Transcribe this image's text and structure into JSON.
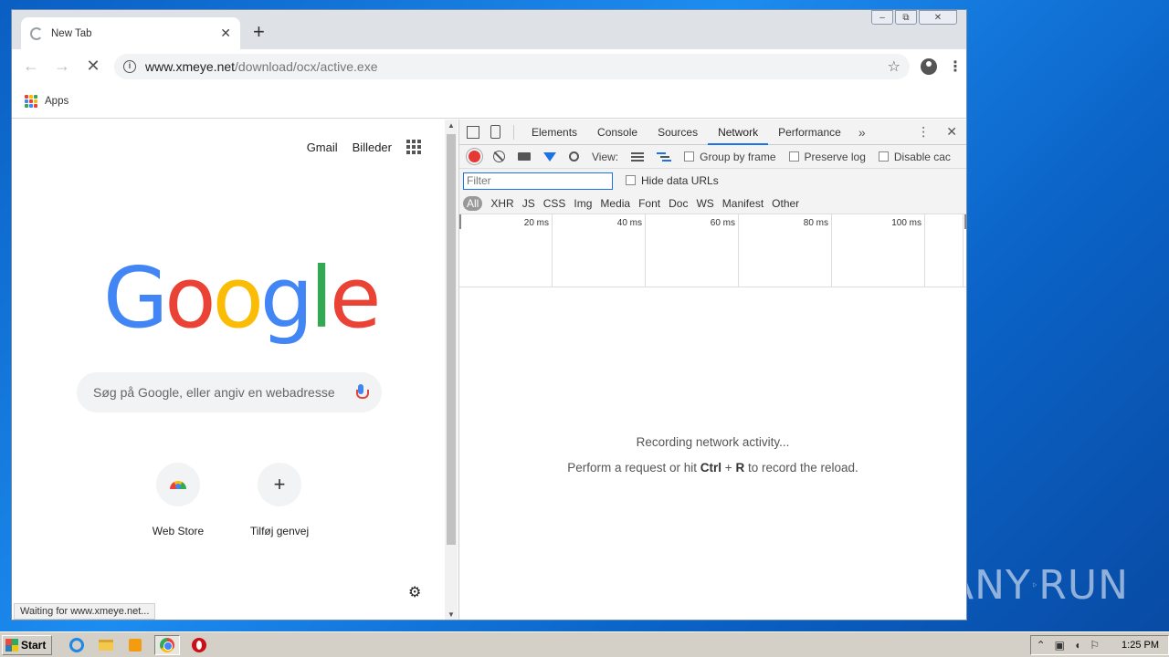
{
  "browser": {
    "tab_title": "New Tab",
    "new_tab_symbol": "+",
    "window_controls": {
      "minimize": "–",
      "restore": "⧉",
      "close": "✕"
    },
    "nav": {
      "back": "←",
      "forward": "→",
      "stop": "✕"
    },
    "address": {
      "host": "www.xmeye.net",
      "path": "/download/ocx/active.exe"
    },
    "bookmarks": {
      "apps_label": "Apps"
    }
  },
  "page": {
    "top_links": [
      "Gmail",
      "Billeder"
    ],
    "logo_letters": [
      {
        "char": "G",
        "color": "#4285f4"
      },
      {
        "char": "o",
        "color": "#ea4335"
      },
      {
        "char": "o",
        "color": "#fbbc05"
      },
      {
        "char": "g",
        "color": "#4285f4"
      },
      {
        "char": "l",
        "color": "#34a853"
      },
      {
        "char": "e",
        "color": "#ea4335"
      }
    ],
    "search_placeholder": "Søg på Google, eller angiv en webadresse",
    "shortcuts": [
      {
        "label": "Web Store",
        "icon": "chrome-webstore-icon"
      },
      {
        "label": "Tilføj genvej",
        "icon": "plus-icon",
        "symbol": "+"
      }
    ],
    "status_text": "Waiting for www.xmeye.net..."
  },
  "devtools": {
    "tabs": [
      "Elements",
      "Console",
      "Sources",
      "Network",
      "Performance"
    ],
    "active_tab": "Network",
    "toolbar": {
      "view_label": "View:",
      "group_by_frame": "Group by frame",
      "preserve_log": "Preserve log",
      "disable_cache": "Disable cac"
    },
    "filter_placeholder": "Filter",
    "hide_data_urls": "Hide data URLs",
    "types": [
      "All",
      "XHR",
      "JS",
      "CSS",
      "Img",
      "Media",
      "Font",
      "Doc",
      "WS",
      "Manifest",
      "Other"
    ],
    "timeline_ticks": [
      "20 ms",
      "40 ms",
      "60 ms",
      "80 ms",
      "100 ms",
      ""
    ],
    "empty_line1": "Recording network activity...",
    "empty_line2_pre": "Perform a request or hit ",
    "empty_key1": "Ctrl",
    "empty_plus": " + ",
    "empty_key2": "R",
    "empty_line2_post": " to record the reload."
  },
  "taskbar": {
    "start_label": "Start",
    "clock": "1:25 PM"
  },
  "watermark": {
    "text": "ANY",
    "text2": "RUN"
  }
}
